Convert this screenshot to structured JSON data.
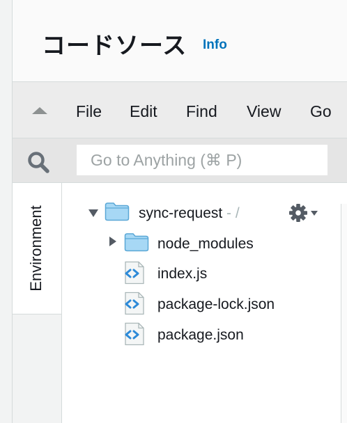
{
  "header": {
    "title": "コードソース",
    "info_label": "Info"
  },
  "menubar": {
    "items": [
      {
        "label": "File"
      },
      {
        "label": "Edit"
      },
      {
        "label": "Find"
      },
      {
        "label": "View"
      },
      {
        "label": "Go"
      }
    ]
  },
  "search": {
    "placeholder": "Go to Anything (⌘ P)",
    "value": ""
  },
  "side_tab": {
    "label": "Environment"
  },
  "tree": {
    "root": {
      "name": "sync-request",
      "suffix": " - /",
      "icon": "folder-icon",
      "expanded": true
    },
    "children": [
      {
        "name": "node_modules",
        "icon": "folder-icon",
        "type": "folder",
        "expanded": false
      },
      {
        "name": "index.js",
        "icon": "code-file-icon",
        "type": "file"
      },
      {
        "name": "package-lock.json",
        "icon": "code-file-icon",
        "type": "file"
      },
      {
        "name": "package.json",
        "icon": "code-file-icon",
        "type": "file"
      }
    ]
  },
  "colors": {
    "accent_link": "#0073bb",
    "folder_fill": "#a7d8f5",
    "folder_stroke": "#5aa7d6",
    "code_icon": "#2d8ad8"
  }
}
